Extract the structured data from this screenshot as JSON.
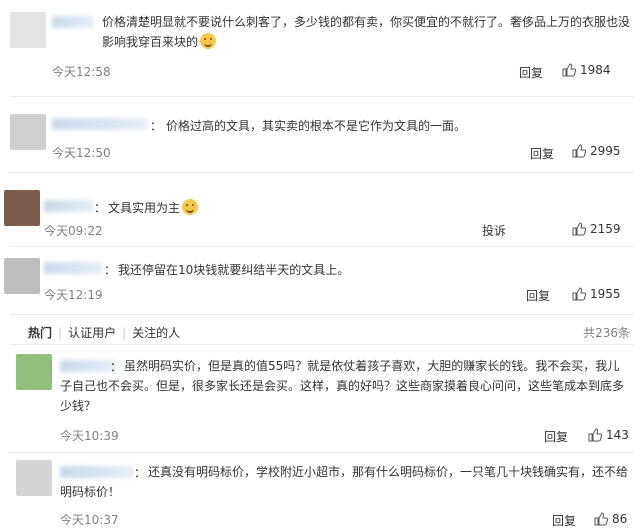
{
  "comments_top": [
    {
      "text": "价格清楚明显就不要说什么刺客了，多少钱的都有卖，你买便宜的不就行了。奢侈品上万的衣服也没影响我穿百来块的",
      "emoji": true,
      "time": "今天12:58",
      "reply_label": "回复",
      "likes": "1984"
    },
    {
      "text": "价格过高的文具，其实卖的根本不是它作为文具的一面。",
      "emoji": false,
      "time": "今天12:50",
      "reply_label": "回复",
      "likes": "2995"
    },
    {
      "text": "文具实用为主",
      "emoji": true,
      "time": "今天09:22",
      "reply_label": "投诉",
      "likes": "2159"
    },
    {
      "text": "我还停留在10块钱就要纠结半天的文具上。",
      "emoji": false,
      "time": "今天12:19",
      "reply_label": "回复",
      "likes": "1955"
    }
  ],
  "tabs": {
    "hot": "热门",
    "verified": "认证用户",
    "following": "关注的人",
    "total": "共236条"
  },
  "comments_bottom": [
    {
      "text": "虽然明码实价，但是真的值55吗？就是依仗着孩子喜欢，大胆的赚家长的钱。我不会买，我儿子自己也不会买。但是，很多家长还是会买。这样，真的好吗？这些商家摸着良心问问，这些笔成本到底多少钱？",
      "time": "今天10:39",
      "reply_label": "回复",
      "likes": "143"
    },
    {
      "text": "还真没有明码标价，学校附近小超市，那有什么明码标价，一只笔几十块钱确实有，还不给明码标价！",
      "time": "今天10:37",
      "reply_label": "回复",
      "likes": "86"
    }
  ],
  "colors": {
    "time": "#808080",
    "divider": "#ececec",
    "namebar": "#c8d9ea"
  },
  "icons": {
    "like": "thumbs-up-icon",
    "emoji": "smile-emoji-icon"
  }
}
